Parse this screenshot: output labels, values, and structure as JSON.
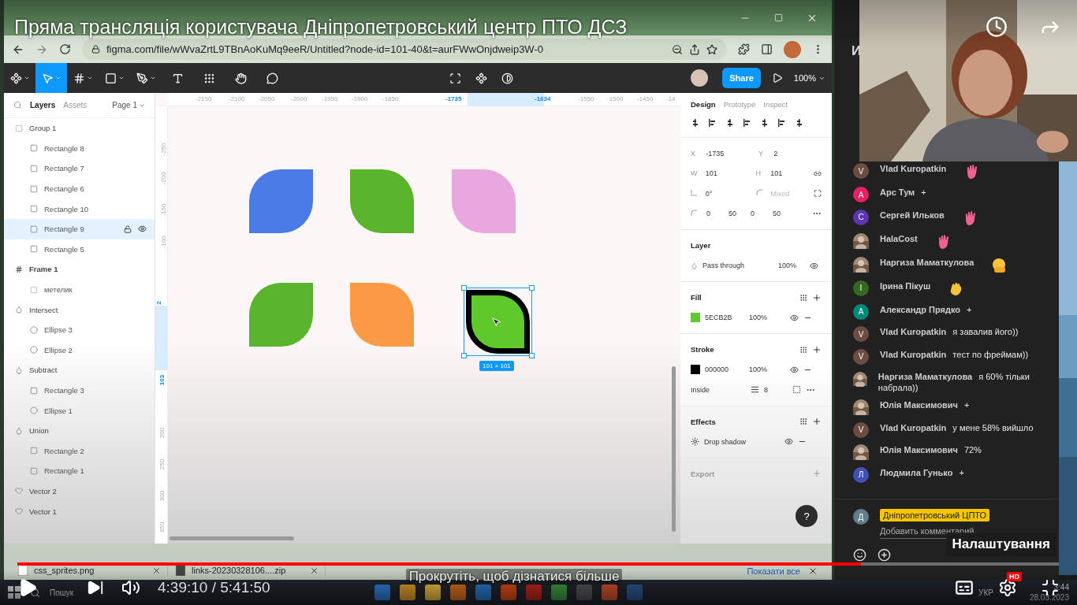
{
  "video": {
    "title": "Пряма трансляція користувача Дніпропетровський центр ПТО ДСЗ",
    "progress": {
      "level": 0.81
    },
    "time": "4:39:10 / 5:41:50",
    "hint": "Прокрутіть, щоб дізнатися більше",
    "hd_badge": "HD",
    "tooltip": "Налаштування"
  },
  "browser": {
    "url": "figma.com/file/wWvaZrtL9TBnAoKuMq9eeR/Untitled?node-id=101-40&t=aurFWwOnjdweip3W-0",
    "downloads": [
      {
        "name": "css_sprites.png"
      },
      {
        "name": "links-20230328106....zip"
      }
    ],
    "show_all": "Показати все"
  },
  "figma": {
    "tools": [
      {
        "kind": "logo",
        "selected": false
      },
      {
        "kind": "move",
        "selected": true
      },
      {
        "kind": "frame",
        "selected": false
      },
      {
        "kind": "shape",
        "selected": false
      },
      {
        "kind": "pen",
        "selected": false
      },
      {
        "kind": "text",
        "selected": false
      },
      {
        "kind": "resources",
        "selected": false
      },
      {
        "kind": "hand",
        "selected": false
      },
      {
        "kind": "comment",
        "selected": false
      }
    ],
    "share": "Share",
    "zoom": "100%",
    "layer_tabs": [
      {
        "label": "Layers",
        "selected": true
      },
      {
        "label": "Assets",
        "selected": false
      }
    ],
    "page": "Page 1",
    "layers": [
      {
        "name": "Group 1",
        "kind": "group",
        "selected": false,
        "children": [
          {
            "name": "Rectangle 8",
            "kind": "leaf",
            "selected": false
          },
          {
            "name": "Rectangle 7",
            "kind": "leaf",
            "selected": false
          },
          {
            "name": "Rectangle 6",
            "kind": "leaf",
            "selected": false
          },
          {
            "name": "Rectangle 10",
            "kind": "leaf",
            "selected": false
          },
          {
            "name": "Rectangle 9",
            "kind": "leaf",
            "selected": true
          },
          {
            "name": "Rectangle 5",
            "kind": "leaf",
            "selected": false
          }
        ]
      },
      {
        "name": "Frame 1",
        "kind": "frame",
        "selected": false,
        "children": [
          {
            "name": "метелик",
            "kind": "group",
            "selected": false
          }
        ]
      },
      {
        "name": "Intersect",
        "kind": "boolean",
        "selected": false,
        "children": [
          {
            "name": "Ellipse 3",
            "kind": "ellipse",
            "selected": false
          },
          {
            "name": "Ellipse 2",
            "kind": "ellipse",
            "selected": false
          }
        ]
      },
      {
        "name": "Subtract",
        "kind": "boolean",
        "selected": false,
        "children": [
          {
            "name": "Rectangle 3",
            "kind": "rectangle",
            "selected": false
          },
          {
            "name": "Ellipse 1",
            "kind": "ellipse",
            "selected": false
          }
        ]
      },
      {
        "name": "Union",
        "kind": "boolean",
        "selected": false,
        "children": [
          {
            "name": "Rectangle 2",
            "kind": "rectangle",
            "selected": false
          },
          {
            "name": "Rectangle 1",
            "kind": "rectangle",
            "selected": false
          }
        ]
      },
      {
        "name": "Vector 2",
        "kind": "vector",
        "selected": false
      },
      {
        "name": "Vector 1",
        "kind": "vector",
        "selected": false
      }
    ],
    "ruler_x": [
      {
        "label": "-2150",
        "selected": false
      },
      {
        "label": "-2100",
        "selected": false
      },
      {
        "label": "-2050",
        "selected": false
      },
      {
        "label": "-2000",
        "selected": false
      },
      {
        "label": "-1950",
        "selected": false
      },
      {
        "label": "-1900",
        "selected": false
      },
      {
        "label": "-1850",
        "selected": false
      },
      {
        "label": "-1735",
        "selected": true
      },
      {
        "label": "-1634",
        "selected": true
      },
      {
        "label": "-1550",
        "selected": false
      },
      {
        "label": "-1500",
        "selected": false
      },
      {
        "label": "-1450",
        "selected": false
      },
      {
        "label": "-14",
        "selected": false
      }
    ],
    "ruler_y": [
      {
        "label": "-250",
        "selected": false
      },
      {
        "label": "-200",
        "selected": false
      },
      {
        "label": "-150",
        "selected": false
      },
      {
        "label": "-100",
        "selected": false
      },
      {
        "label": "2",
        "selected": true
      },
      {
        "label": "103",
        "selected": true
      },
      {
        "label": "200",
        "selected": false
      },
      {
        "label": "250",
        "selected": false
      },
      {
        "label": "300",
        "selected": false
      },
      {
        "label": "350",
        "selected": false
      }
    ],
    "shapes": [
      {
        "kind": "leaf-a",
        "color": "#4a7be6",
        "selected": false
      },
      {
        "kind": "leaf-b",
        "color": "#5ab52c",
        "selected": false
      },
      {
        "kind": "leaf-b",
        "color": "#eaa6df",
        "selected": false
      },
      {
        "kind": "leaf-a",
        "color": "#5ab52c",
        "selected": false
      },
      {
        "kind": "leaf-b",
        "color": "#fb9a45",
        "selected": false
      },
      {
        "kind": "leaf-b",
        "color": "#5ecb2b",
        "selected": true
      }
    ],
    "size_label": "101 × 101",
    "design_tabs": [
      {
        "label": "Design",
        "selected": true
      },
      {
        "label": "Prototype",
        "selected": false
      },
      {
        "label": "Inspect",
        "selected": false
      }
    ],
    "fields": [
      {
        "label": "X",
        "value": "-1735"
      },
      {
        "label": "Y",
        "value": "2"
      },
      {
        "label": "W",
        "value": "101"
      },
      {
        "label": "H",
        "value": "101"
      }
    ],
    "rotation": "0°",
    "radius_placeholder": "Mixed",
    "corners": [
      "0",
      "50",
      "0",
      "50"
    ],
    "layer": {
      "title": "Layer",
      "blend": "Pass through",
      "opacity": "100%"
    },
    "fill": {
      "title": "Fill",
      "color": "#5ecb2b",
      "hex": "5ECB2B",
      "opacity": "100%"
    },
    "stroke": {
      "title": "Stroke",
      "color": "#000000",
      "hex": "000000",
      "opacity": "100%",
      "position": "Inside",
      "weight": "8"
    },
    "effects": {
      "title": "Effects",
      "name": "Drop shadow"
    },
    "export": {
      "title": "Export"
    },
    "help": "?"
  },
  "chat": {
    "header": "И",
    "messages": [
      {
        "name": "Vlad Kuropatkin",
        "avatar": {
          "kind": "letter",
          "letter": "V",
          "color": "#6d4c41"
        },
        "kind": "wave"
      },
      {
        "name": "Арс Тум",
        "avatar": {
          "kind": "letter",
          "letter": "A",
          "color": "#e91e63"
        },
        "kind": "text",
        "text": "+"
      },
      {
        "name": "Сергей Ильков",
        "avatar": {
          "kind": "letter",
          "letter": "C",
          "color": "#5e35b1"
        },
        "kind": "wave"
      },
      {
        "name": "HalaCost",
        "kind": "wave"
      },
      {
        "name": "Наргиза Маматкулова",
        "kind": "hug"
      },
      {
        "name": "Ірина Пікуш",
        "avatar": {
          "kind": "letter",
          "letter": "I",
          "color": "#33691e"
        },
        "kind": "clap"
      },
      {
        "name": "Александр Прядко",
        "avatar": {
          "kind": "letter",
          "letter": "A",
          "color": "#00897b"
        },
        "kind": "text",
        "text": "+"
      },
      {
        "name": "Vlad Kuropatkin",
        "avatar": {
          "kind": "letter",
          "letter": "V",
          "color": "#6d4c41"
        },
        "kind": "text",
        "text": "я завалив його))"
      },
      {
        "name": "Vlad Kuropatkin",
        "avatar": {
          "kind": "letter",
          "letter": "V",
          "color": "#6d4c41"
        },
        "kind": "text",
        "text": "тест по фреймам))"
      },
      {
        "name": "Наргиза Маматкулова",
        "kind": "text",
        "text": "я 60% тільки набрала))"
      },
      {
        "name": "Юлія Максимович",
        "kind": "text",
        "text": "+"
      },
      {
        "name": "Vlad Kuropatkin",
        "avatar": {
          "kind": "letter",
          "letter": "V",
          "color": "#6d4c41"
        },
        "kind": "text",
        "text": "у мене 58% вийшло"
      },
      {
        "name": "Юлія Максимович",
        "kind": "text",
        "text": "72%"
      },
      {
        "name": "Людмила Гунько",
        "avatar": {
          "kind": "letter",
          "letter": "Л",
          "color": "#3f51b5"
        },
        "kind": "text",
        "text": "+"
      }
    ],
    "me": {
      "letter": "Д",
      "color": "#607d8b"
    },
    "author": "Дніпропетровський ЦПТО",
    "placeholder": "Добавить комментарий..."
  },
  "taskbar": {
    "search": "Пошук",
    "language": "УКР",
    "time": "3:44",
    "date": "28.03.2023"
  }
}
